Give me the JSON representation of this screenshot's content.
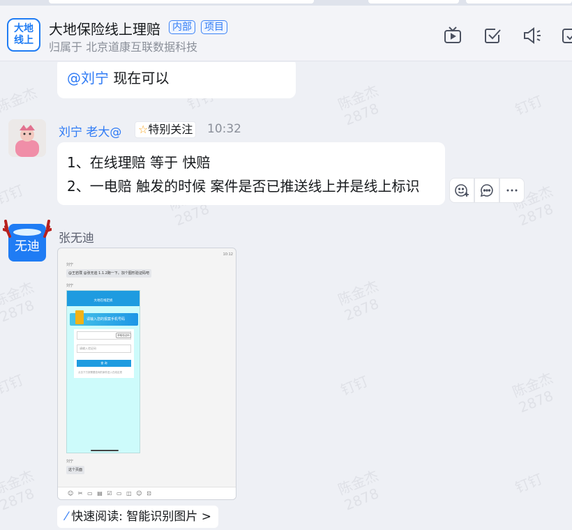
{
  "group": {
    "avatar_line1": "大地",
    "avatar_line2": "线上",
    "title": "大地保险线上理赔",
    "tag_internal": "内部",
    "tag_project": "项目",
    "subtitle": "归属于 北京道康互联数据科技"
  },
  "header_icons": [
    "tv-icon",
    "checkbox-icon",
    "speaker-icon",
    "more-panel-icon"
  ],
  "watermark": {
    "name": "陈金杰",
    "code": "2878",
    "app": "钉钉"
  },
  "messages": [
    {
      "mention": "@刘宁",
      "text": " 现在可以"
    },
    {
      "sender": "刘宁 老大@",
      "special_tag": "特别关注",
      "time": "10:32",
      "lines": [
        "1、在线理赔 等于 快赔",
        "2、一电赔 触发的时候 案件是否已推送线上并是线上标识"
      ]
    },
    {
      "sender": "张无迪",
      "avatar_text": "无迪",
      "quick_read": "快速阅读: 智能识别图片 >",
      "image": {
        "time": "10:12",
        "sender_a": "刘宁",
        "bubble_a": "@王岩璞 @张无迪 1.1.2跑一下。加个图形验证码吧",
        "sender_b": "刘宁",
        "phone_title": "大地在线定损",
        "banner_text": "请输入您的报案手机号码",
        "verify_button": "获取验证码",
        "code_placeholder": "请输入验证码",
        "query_button": "查 询",
        "notice": "点击下方按需要查询的案件进入在线定损",
        "sender_c": "刘宁",
        "bubble_c": "这个页面"
      }
    }
  ]
}
